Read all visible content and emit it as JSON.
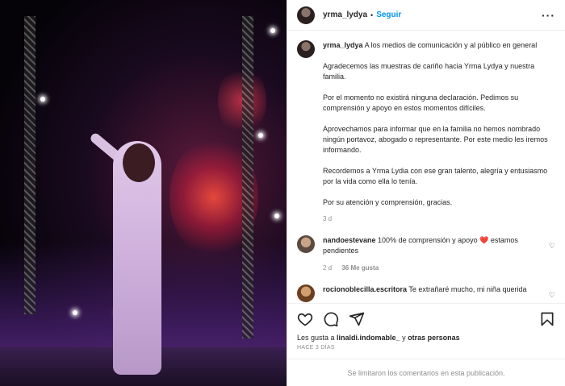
{
  "header": {
    "username": "yrma_lydya",
    "dot": "•",
    "follow_label": "Seguir",
    "more_label": "···"
  },
  "caption": {
    "username": "yrma_lydya",
    "paragraphs": [
      "A los medios de comunicación y al público en general",
      "Agradecemos las muestras de cariño hacia Yrma Lydya y nuestra familia.",
      "Por el momento no existirá ninguna declaración. Pedimos su comprensión y apoyo en estos momentos difíciles.",
      "Aprovechamos para informar que en la familia no hemos nombrado ningún portavoz, abogado o representante. Por este medio les iremos informando.",
      "Recordemos a Yrma Lydia con ese gran talento, alegría y entusiasmo por la vida como ella lo tenía.",
      "Por su atención y comprensión, gracias."
    ],
    "time": "3 d"
  },
  "comments": [
    {
      "username": "nandoestevane",
      "text": "100% de comprensión y apoyo ❤️ estamos pendientes",
      "time": "2 d",
      "likes": "36 Me gusta"
    },
    {
      "username": "rocionoblecilla.escritora",
      "text": "Te extrañaré mucho, mi niña querida"
    }
  ],
  "likes": {
    "prefix": "Les gusta a ",
    "user": "linaldi.indomable_",
    "connector": " y ",
    "others": "otras personas"
  },
  "ago": "HACE 3 DÍAS",
  "comments_limited": "Se limitaron los comentarios en esta publicación.",
  "icons": {
    "like": "heart-icon",
    "comment": "comment-icon",
    "share": "share-icon",
    "save": "bookmark-icon"
  }
}
